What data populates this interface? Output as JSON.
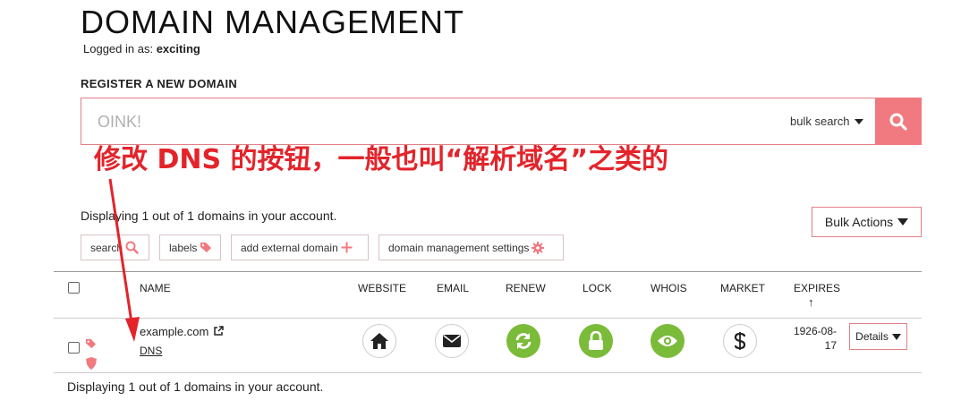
{
  "page": {
    "title": "DOMAIN MANAGEMENT",
    "logged_in_label": "Logged in as:",
    "username": "exciting"
  },
  "register": {
    "heading": "REGISTER A NEW DOMAIN",
    "search_placeholder": "OINK!",
    "bulk_search_label": "bulk search"
  },
  "annotation": {
    "text": "修改 DNS 的按钮，一般也叫“解析域名”之类的",
    "color": "#e3242b"
  },
  "summary": {
    "top_text": "Displaying 1 out of 1 domains in your account.",
    "bottom_text": "Displaying 1 out of 1 domains in your account.",
    "bulk_actions_label": "Bulk Actions"
  },
  "toolbar": {
    "search_label": "search",
    "labels_label": "labels",
    "add_external_label": "add external domain",
    "settings_label": "domain management settings"
  },
  "table": {
    "headers": {
      "name": "NAME",
      "website": "WEBSITE",
      "email": "EMAIL",
      "renew": "RENEW",
      "lock": "LOCK",
      "whois": "WHOIS",
      "market": "MARKET",
      "expires": "EXPIRES",
      "sort_indicator": "↑"
    },
    "rows": [
      {
        "domain": "example.com",
        "dns_link": "DNS",
        "expires_line1": "1926-08-",
        "expires_line2": "17",
        "details_label": "Details"
      }
    ]
  },
  "icons": {
    "website": "home-icon",
    "email": "envelope-icon",
    "renew": "refresh-icon",
    "lock": "lock-icon",
    "whois": "eye-icon",
    "market": "dollar-icon",
    "search_button": "search-icon"
  },
  "colors": {
    "accent": "#f07a80",
    "green": "#7bbb3a",
    "dark_icon": "#222222",
    "annotation_red": "#e3242b"
  }
}
